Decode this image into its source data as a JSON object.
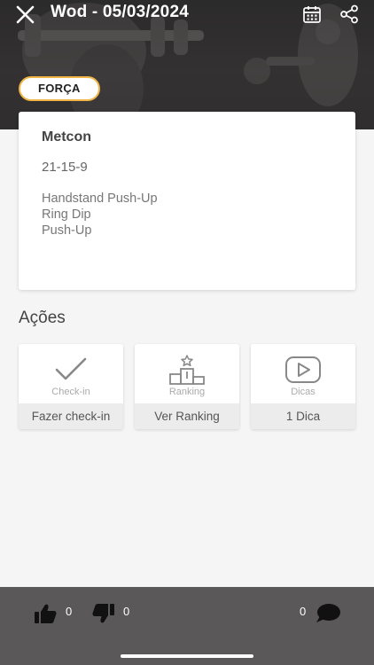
{
  "header": {
    "title": "Wod - 05/03/2024",
    "category_tag": "FORÇA"
  },
  "workout": {
    "title": "Metcon",
    "scheme": "21-15-9",
    "movements": [
      "Handstand Push-Up",
      "Ring Dip",
      "Push-Up"
    ]
  },
  "actions": {
    "title": "Ações",
    "items": [
      {
        "icon": "check-icon",
        "sublabel": "Check-in",
        "label": "Fazer check-in"
      },
      {
        "icon": "podium-icon",
        "sublabel": "Ranking",
        "label": "Ver Ranking"
      },
      {
        "icon": "play-icon",
        "sublabel": "Dicas",
        "label": "1 Dica"
      }
    ]
  },
  "footer": {
    "likes": "0",
    "dislikes": "0",
    "comments": "0"
  },
  "colors": {
    "accent": "#f0b545",
    "hero_bg": "#333131",
    "footer_bg": "#5a5858"
  }
}
